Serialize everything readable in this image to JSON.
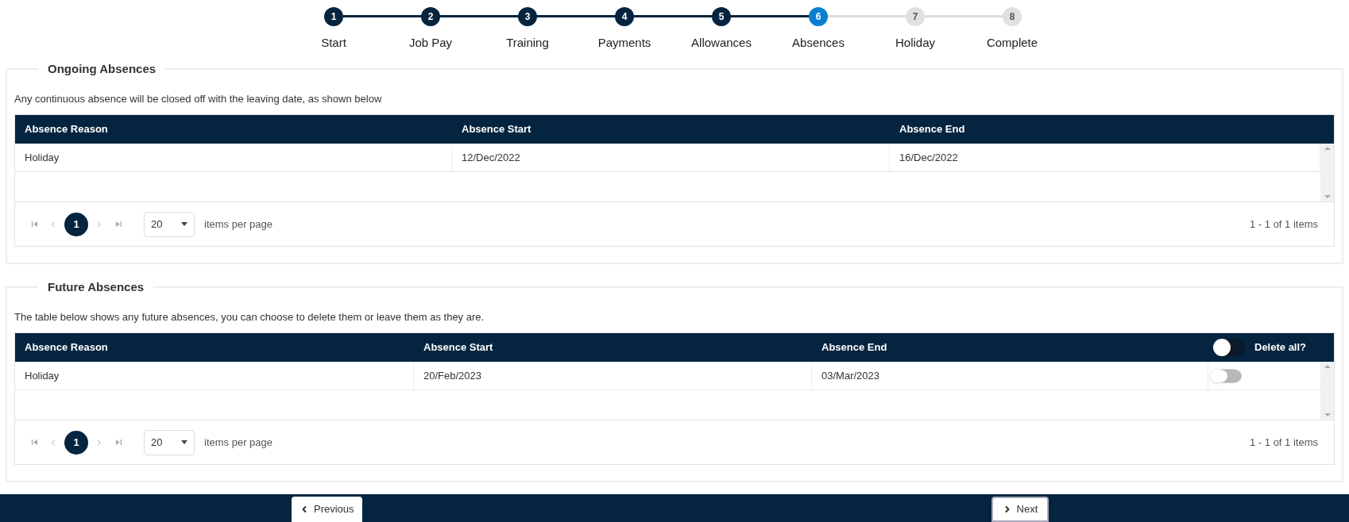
{
  "steps": [
    {
      "number": "1",
      "label": "Start",
      "completed": true,
      "selected": false
    },
    {
      "number": "2",
      "label": "Job Pay",
      "completed": true,
      "selected": false
    },
    {
      "number": "3",
      "label": "Training",
      "completed": true,
      "selected": false
    },
    {
      "number": "4",
      "label": "Payments",
      "completed": true,
      "selected": false
    },
    {
      "number": "5",
      "label": "Allowances",
      "completed": true,
      "selected": false
    },
    {
      "number": "6",
      "label": "Absences",
      "completed": false,
      "selected": true
    },
    {
      "number": "7",
      "label": "Holiday",
      "completed": false,
      "selected": false
    },
    {
      "number": "8",
      "label": "Complete",
      "completed": false,
      "selected": false
    }
  ],
  "sections": [
    {
      "legend": "Ongoing Absences",
      "description": "Any continuous absence will be closed off with the leaving date, as shown below",
      "columns": [
        "Absence Reason",
        "Absence Start",
        "Absence End"
      ],
      "rows": [
        {
          "cells": [
            "Holiday",
            "12/Dec/2022",
            "16/Dec/2022"
          ]
        }
      ],
      "pager": {
        "pages": [
          {
            "label": "1",
            "selected": true
          }
        ],
        "page_size": "20",
        "page_size_label": "items per page",
        "summary": "1 - 1 of 1 items"
      }
    },
    {
      "legend": "Future Absences",
      "description": "The table below shows any future absences, you can choose to delete them or leave them as they are.",
      "columns": [
        "Absence Reason",
        "Absence Start",
        "Absence End"
      ],
      "delete_all": {
        "label": "Delete all?",
        "on": false
      },
      "rows": [
        {
          "cells": [
            "Holiday",
            "20/Feb/2023",
            "03/Mar/2023"
          ],
          "delete": false
        }
      ],
      "pager": {
        "pages": [
          {
            "label": "1",
            "selected": true
          }
        ],
        "page_size": "20",
        "page_size_label": "items per page",
        "summary": "1 - 1 of 1 items"
      }
    }
  ],
  "footer": {
    "previous": "Previous",
    "next": "Next"
  }
}
